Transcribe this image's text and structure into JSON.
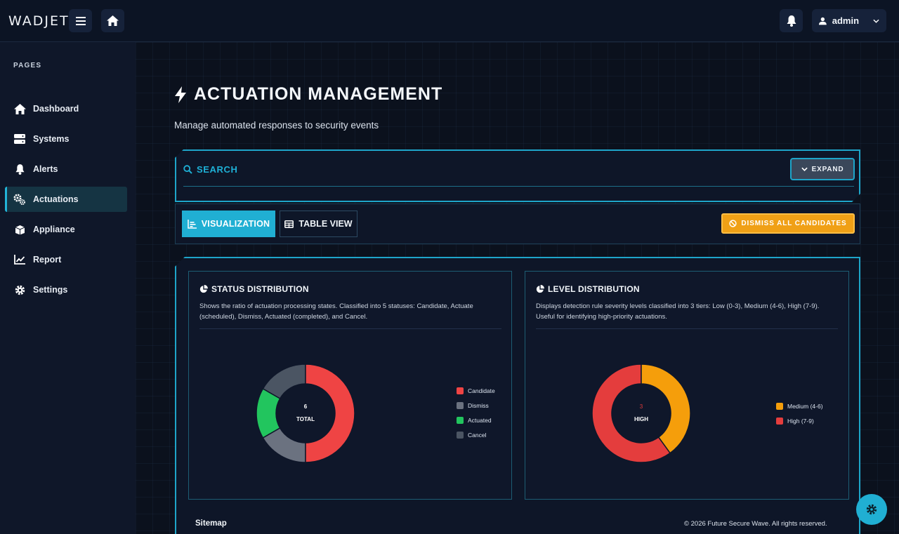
{
  "header": {
    "brand": "WADJET",
    "user": "admin",
    "icons": [
      "menu-icon",
      "home-icon",
      "bell-icon",
      "user-icon",
      "chevron-down-icon"
    ]
  },
  "sidebar": {
    "section_label": "PAGES",
    "items": [
      {
        "label": "Dashboard",
        "icon": "home-icon"
      },
      {
        "label": "Systems",
        "icon": "server-icon"
      },
      {
        "label": "Alerts",
        "icon": "bell-icon"
      },
      {
        "label": "Actuations",
        "icon": "gears-icon",
        "active": true
      },
      {
        "label": "Appliance",
        "icon": "box-icon"
      },
      {
        "label": "Report",
        "icon": "chart-line-icon"
      },
      {
        "label": "Settings",
        "icon": "gear-icon"
      }
    ]
  },
  "page": {
    "title": "ACTUATION MANAGEMENT",
    "subtitle": "Manage automated responses to security events"
  },
  "search": {
    "label": "SEARCH",
    "expand_label": "EXPAND"
  },
  "views": {
    "visualization_label": "VISUALIZATION",
    "table_label": "TABLE VIEW",
    "dismiss_label": "DISMISS ALL CANDIDATES"
  },
  "status_card": {
    "title": "STATUS DISTRIBUTION",
    "description": "Shows the ratio of actuation processing states. Classified into 5 statuses: Candidate, Actuate (scheduled), Dismiss, Actuated (completed), and Cancel.",
    "center_value": "6",
    "center_label": "TOTAL"
  },
  "level_card": {
    "title": "LEVEL DISTRIBUTION",
    "description": "Displays detection rule severity levels classified into 3 tiers: Low (0-3), Medium (4-6), High (7-9). Useful for identifying high-priority actuations.",
    "center_value": "3",
    "center_label": "HIGH"
  },
  "chart_data": [
    {
      "type": "pie",
      "title": "STATUS DISTRIBUTION",
      "categories": [
        "Candidate",
        "Dismiss",
        "Actuated",
        "Cancel"
      ],
      "values": [
        3,
        1,
        1,
        1
      ],
      "colors": [
        "#ef4444",
        "#6b7280",
        "#22c55e",
        "#4b5563"
      ]
    },
    {
      "type": "pie",
      "title": "LEVEL DISTRIBUTION",
      "categories": [
        "Medium (4-6)",
        "High (7-9)"
      ],
      "values": [
        2,
        3
      ],
      "colors": [
        "#f59e0b",
        "#e43d3d"
      ]
    }
  ],
  "footer": {
    "sitemap": "Sitemap",
    "copyright": "© 2026 Future Secure Wave. All rights reserved."
  }
}
